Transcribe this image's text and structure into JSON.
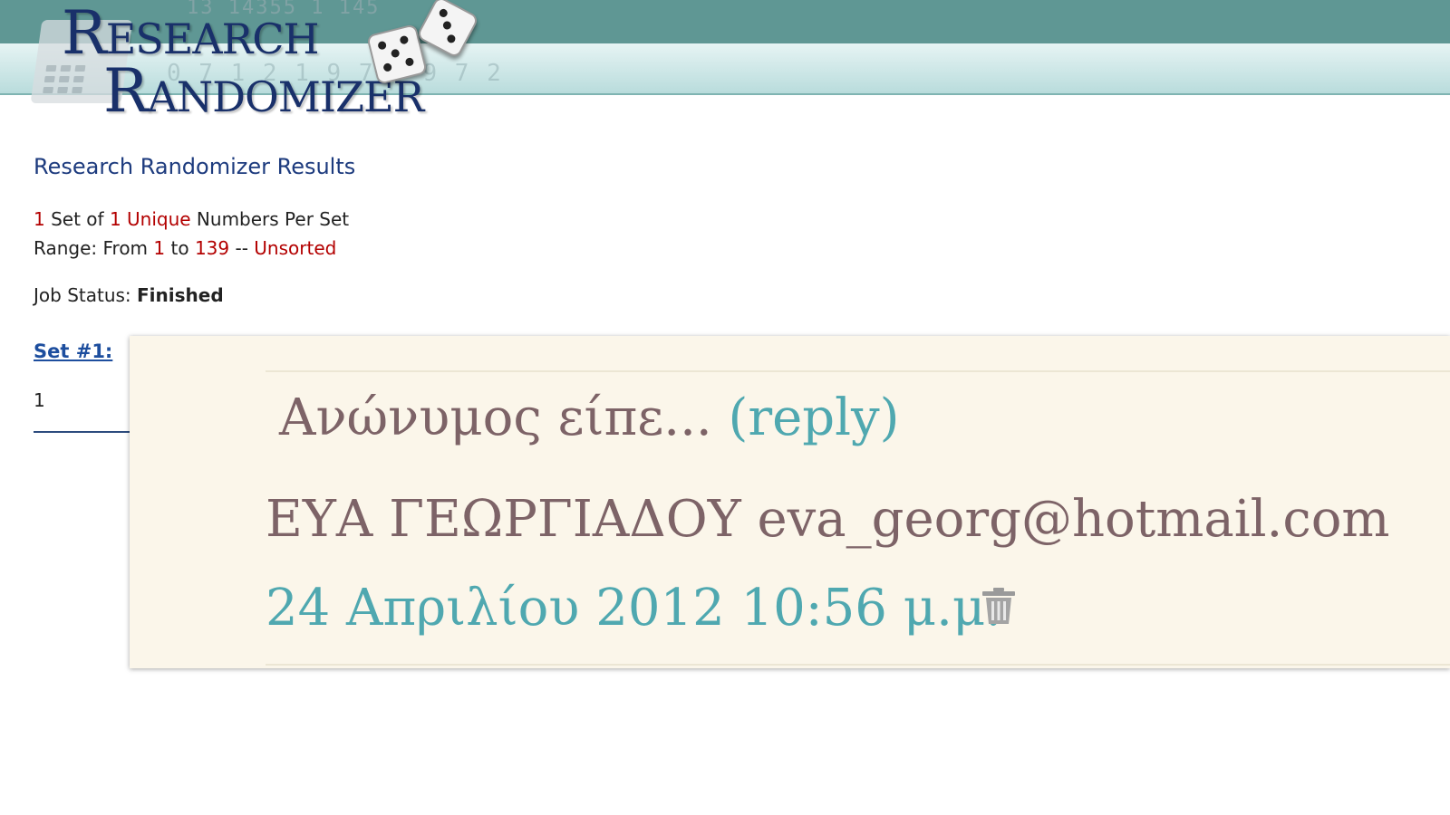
{
  "logo": {
    "line1": "Research",
    "line2": "Randomizer",
    "digits_top": "13 14355 1 145",
    "digits_bottom": "0 7 1 2 1 9 7 3 9 7 2"
  },
  "results": {
    "title": "Research Randomizer Results",
    "sets_count": "1",
    "set_of_text": " Set of ",
    "per_set_count": "1",
    "unique_text": " Unique",
    "numbers_per_set_text": " Numbers Per Set",
    "range_prefix": "Range: From ",
    "range_from": "1",
    "range_to_text": " to ",
    "range_to": "139",
    "range_sep": " -- ",
    "sort_mode": "Unsorted",
    "status_label": "Job Status: ",
    "status_value": "Finished",
    "set_link": "Set #1:",
    "set_values": "1"
  },
  "comment": {
    "author": "Ανώνυμος είπε... ",
    "reply_label": "(reply)",
    "body": "ΕΥΑ ΓΕΩΡΓΙΑΔΟΥ eva_georg@hotmail.com",
    "timestamp": "24 Απριλίου 2012 10:56 μ.μ."
  },
  "colors": {
    "band_dark": "#5f9794",
    "accent_red": "#b30000",
    "title_blue": "#1d3b7e",
    "comment_bg": "#fbf6ea",
    "comment_text": "#7d6367",
    "comment_link": "#4fa8b0"
  },
  "icons": [
    "calculator-icon",
    "dice-icon",
    "trash-icon"
  ]
}
